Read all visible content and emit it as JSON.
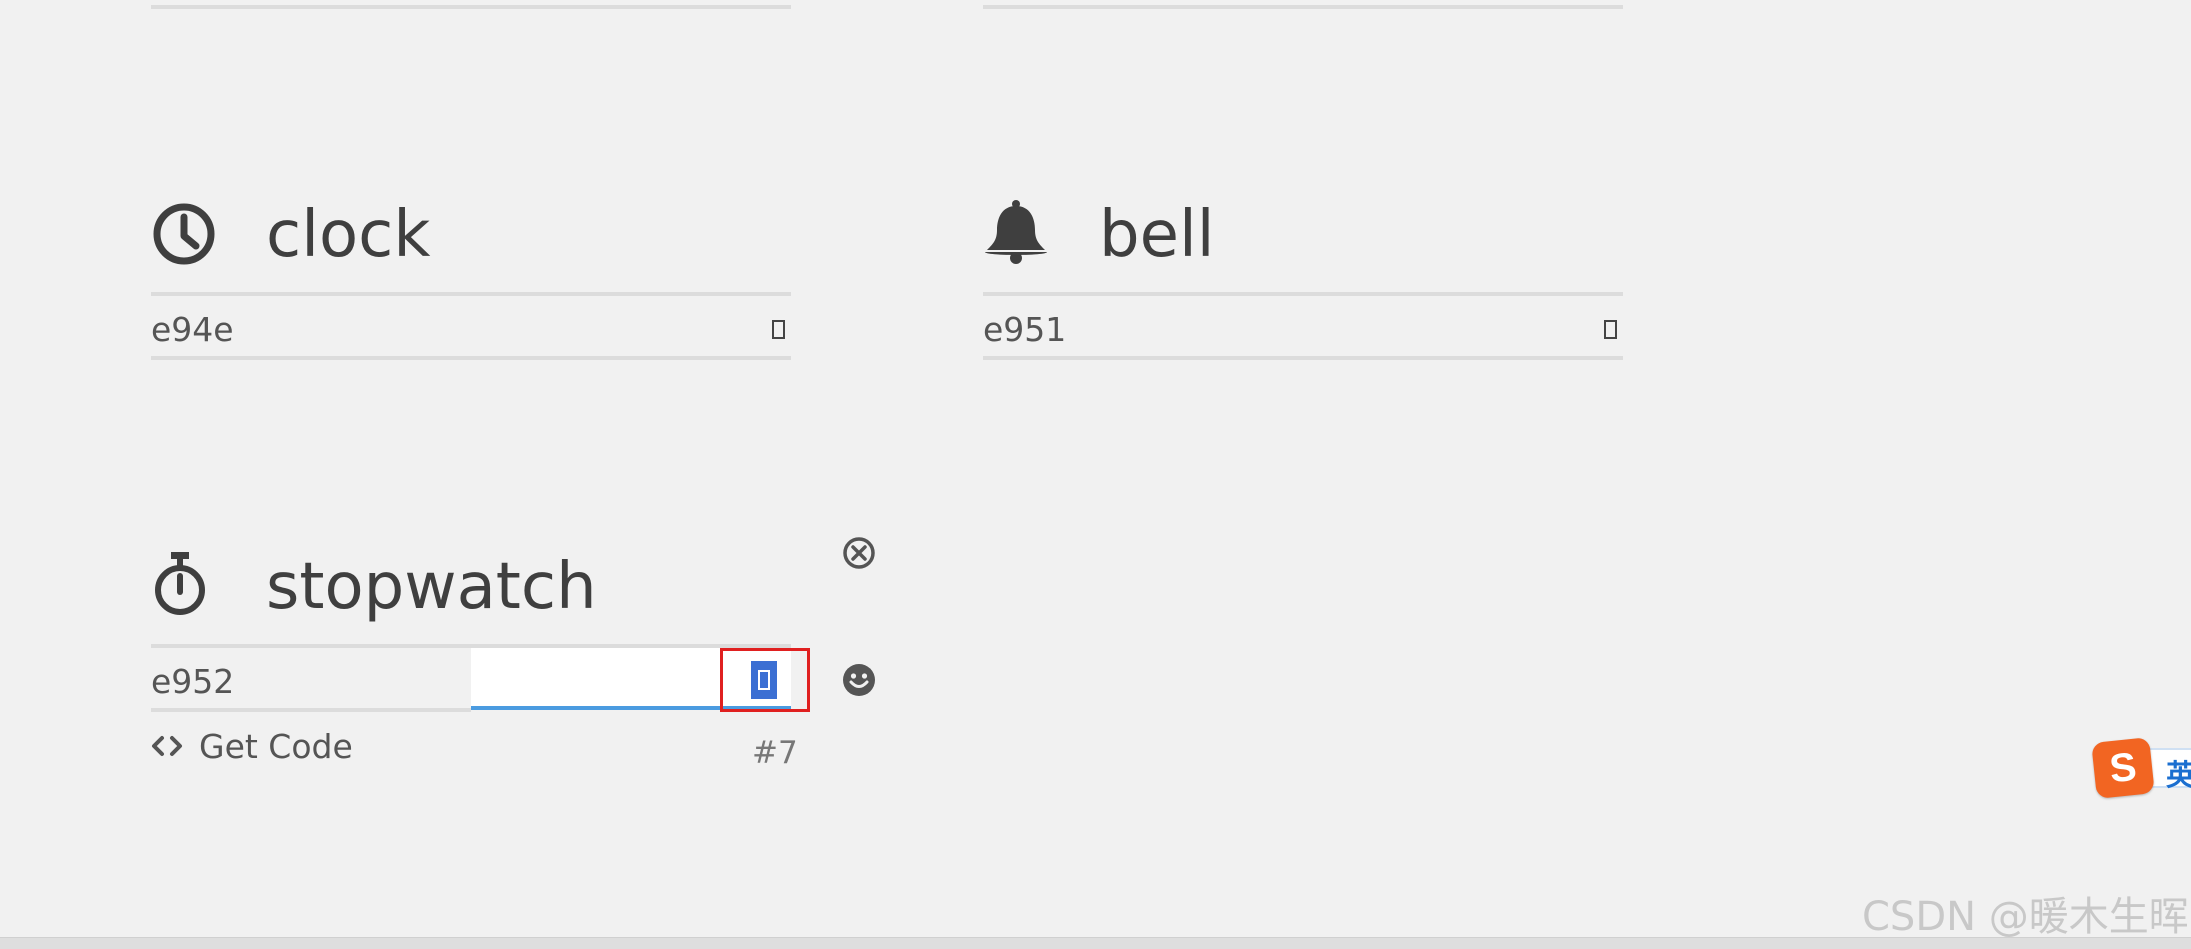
{
  "glyphs": [
    {
      "name": "clock",
      "code": "e94e",
      "icon": "clock-icon"
    },
    {
      "name": "bell",
      "code": "e951",
      "icon": "bell-icon"
    },
    {
      "name": "stopwatch",
      "code": "e952",
      "icon": "stopwatch-icon",
      "index": "#7",
      "get_code_label": "Get Code"
    }
  ],
  "ime_badge": {
    "label": "英",
    "icon": "sogou-ime-icon"
  },
  "watermark": "CSDN @暖木生晖",
  "colors": {
    "background": "#f1f1f1",
    "text": "#444444",
    "input_underline": "#4a9be0",
    "highlight_box": "#e02020",
    "selected_glyph": "#3b6fd3"
  }
}
